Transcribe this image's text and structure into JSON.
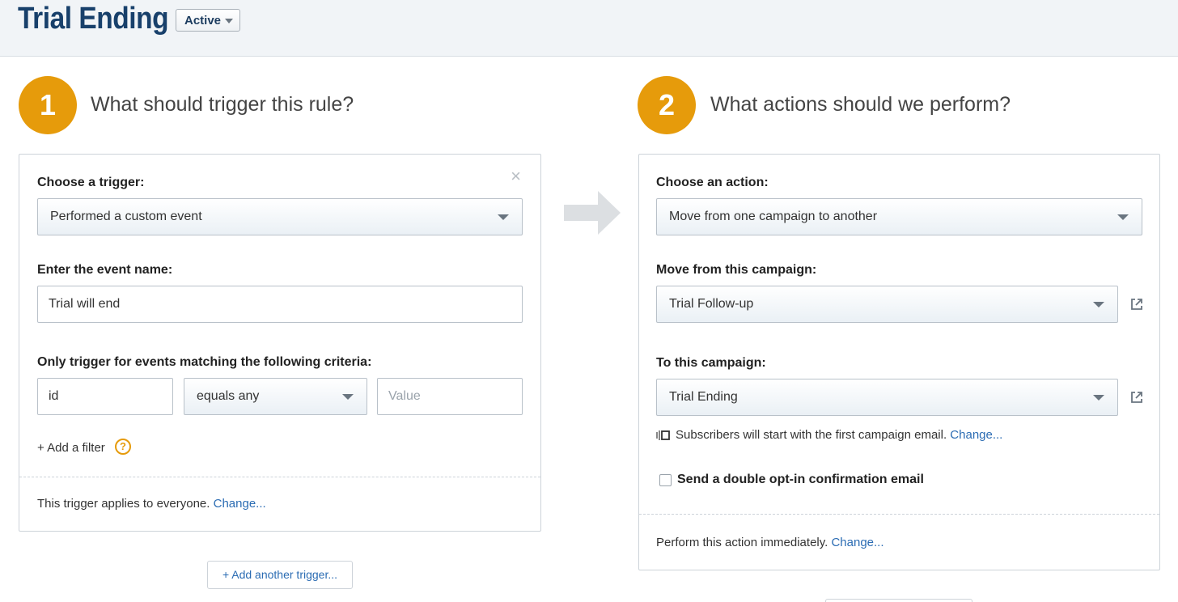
{
  "header": {
    "title": "Trial Ending",
    "status": "Active"
  },
  "step1": {
    "number": "1",
    "heading": "What should trigger this rule?",
    "trigger_label": "Choose a trigger:",
    "trigger_value": "Performed a custom event",
    "event_label": "Enter the event name:",
    "event_value": "Trial will end",
    "criteria_label": "Only trigger for events matching the following criteria:",
    "filter_field": "id",
    "filter_operator": "equals any",
    "filter_value_placeholder": "Value",
    "add_filter": "+ Add a filter",
    "applies_text": "This trigger applies to everyone.",
    "change_link": "Change...",
    "add_trigger": "+ Add another trigger..."
  },
  "step2": {
    "number": "2",
    "heading": "What actions should we perform?",
    "action_label": "Choose an action:",
    "action_value": "Move from one campaign to another",
    "from_label": "Move from this campaign:",
    "from_value": "Trial Follow-up",
    "to_label": "To this campaign:",
    "to_value": "Trial Ending",
    "start_text": "Subscribers will start with the first campaign email.",
    "start_change": "Change...",
    "optin_label": "Send a double opt-in confirmation email",
    "perform_text": "Perform this action immediately.",
    "perform_change": "Change..."
  },
  "icons": {
    "close": "close-icon",
    "help": "question-circle-icon",
    "external": "external-link-icon",
    "arrow": "arrow-right-icon",
    "campaign": "campaign-email-icon"
  },
  "colors": {
    "accent": "#e69b0b",
    "title": "#18406b",
    "link": "#2b6cb3"
  }
}
